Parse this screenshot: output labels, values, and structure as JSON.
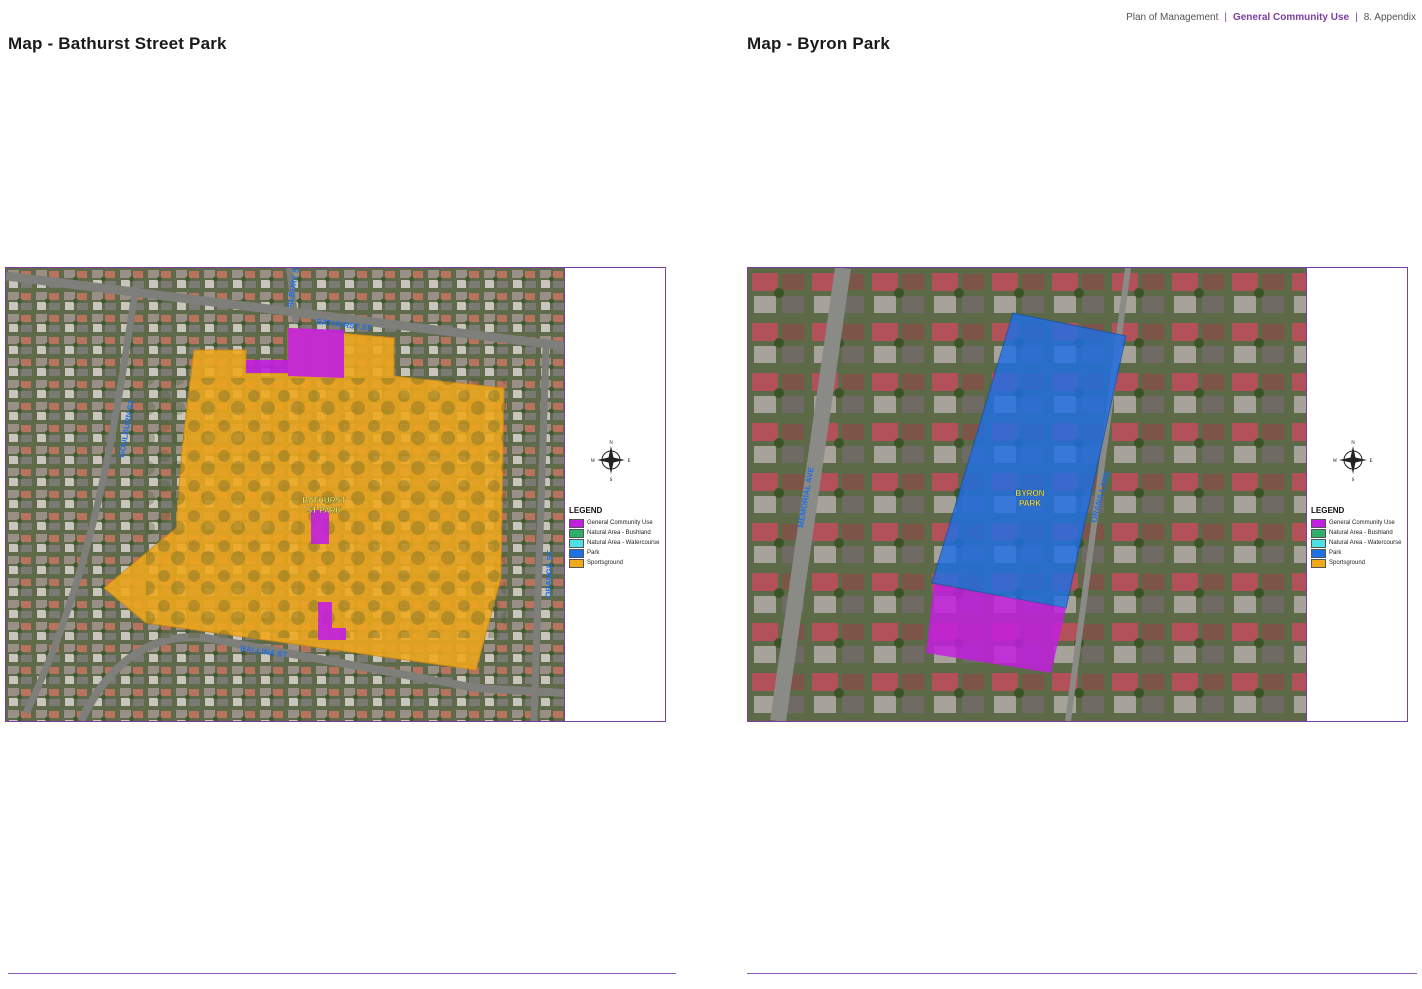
{
  "header": {
    "doc_title": "Plan of Management",
    "section": "General Community Use",
    "chapter": "8. Appendix"
  },
  "left_page": {
    "title": "Map - Bathurst Street Park",
    "park_label_line1": "BATHURST",
    "park_label_line2": "ST PARK",
    "streets": [
      "BATHURST ST",
      "BALLINA ST",
      "GOULBURN ST",
      "ALBURY ST",
      "ORANGE ST"
    ]
  },
  "right_page": {
    "title": "Map - Byron Park",
    "park_label_line1": "BYRON",
    "park_label_line2": "PARK",
    "streets": [
      "MEMORIAL AVE",
      "ORANA LANE"
    ]
  },
  "compass": {
    "n": "N",
    "s": "S",
    "e": "E",
    "w": "W"
  },
  "legend": {
    "title": "LEGEND",
    "items": [
      {
        "label": "General Community Use",
        "color": "#c21fe0"
      },
      {
        "label": "Natural Area - Bushland",
        "color": "#2fae6a"
      },
      {
        "label": "Natural Area - Watercourse",
        "color": "#4fe0e6"
      },
      {
        "label": "Park",
        "color": "#1f6fe6"
      },
      {
        "label": "Sportsground",
        "color": "#f0a81c"
      }
    ]
  },
  "colors": {
    "accent": "#7b3fa0",
    "sportsground": "#f0a81c",
    "general_community_use": "#c21fe0",
    "park": "#1f6fe6"
  }
}
